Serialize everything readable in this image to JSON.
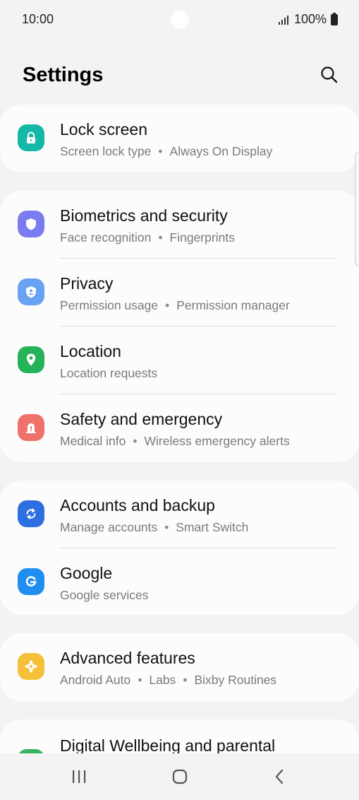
{
  "status_bar": {
    "time": "10:00",
    "battery_text": "100%"
  },
  "header": {
    "title": "Settings",
    "search_icon": "search-icon"
  },
  "colors": {
    "background": "#f3f3f3",
    "card": "#fcfcfc",
    "lock": "#14b8a6",
    "biometrics": "#7a7cf0",
    "privacy": "#6aa2f3",
    "location": "#25b35a",
    "safety": "#f0706a",
    "accounts": "#2d6fe0",
    "google": "#1f8ef0",
    "advanced": "#f7c03b",
    "wellbeing": "#35b35e"
  },
  "cards": [
    {
      "items": [
        {
          "icon": "lock-icon",
          "title": "Lock screen",
          "subtitle": [
            "Screen lock type",
            "Always On Display"
          ]
        }
      ]
    },
    {
      "items": [
        {
          "icon": "shield-icon",
          "title": "Biometrics and security",
          "subtitle": [
            "Face recognition",
            "Fingerprints"
          ]
        },
        {
          "icon": "privacy-shield-icon",
          "title": "Privacy",
          "subtitle": [
            "Permission usage",
            "Permission manager"
          ]
        },
        {
          "icon": "location-pin-icon",
          "title": "Location",
          "subtitle": [
            "Location requests"
          ]
        },
        {
          "icon": "emergency-alert-icon",
          "title": "Safety and emergency",
          "subtitle": [
            "Medical info",
            "Wireless emergency alerts"
          ]
        }
      ]
    },
    {
      "items": [
        {
          "icon": "sync-icon",
          "title": "Accounts and backup",
          "subtitle": [
            "Manage accounts",
            "Smart Switch"
          ]
        },
        {
          "icon": "google-icon",
          "title": "Google",
          "subtitle": [
            "Google services"
          ]
        }
      ]
    },
    {
      "items": [
        {
          "icon": "puzzle-gear-icon",
          "title": "Advanced features",
          "subtitle": [
            "Android Auto",
            "Labs",
            "Bixby Routines"
          ]
        }
      ]
    },
    {
      "items": [
        {
          "icon": "wellbeing-icon",
          "title": "Digital Wellbeing and parental",
          "subtitle": []
        }
      ]
    }
  ],
  "nav_bar": {
    "recents_icon": "recents-icon",
    "home_icon": "home-icon",
    "back_icon": "back-icon"
  }
}
